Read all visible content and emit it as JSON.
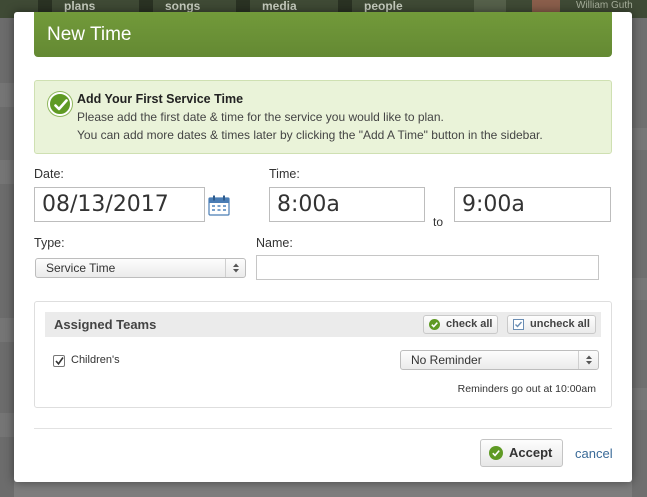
{
  "background": {
    "nav_items": [
      "plans",
      "songs",
      "media",
      "people"
    ],
    "user_name": "William Guth"
  },
  "modal": {
    "title": "New Time",
    "notice": {
      "title": "Add Your First Service Time",
      "line1": "Please add the first date & time for the service you would like to plan.",
      "line2": "You can add more dates & times later by clicking the \"Add A Time\" button in the sidebar."
    },
    "date": {
      "label": "Date:",
      "value": "08/13/2017"
    },
    "time": {
      "label": "Time:",
      "start": "8:00a",
      "separator": "to",
      "end": "9:00a"
    },
    "type": {
      "label": "Type:",
      "selected": "Service Time"
    },
    "name": {
      "label": "Name:",
      "value": ""
    },
    "teams": {
      "title": "Assigned Teams",
      "check_all_label": "check all",
      "uncheck_all_label": "uncheck all",
      "items": [
        {
          "name": "Children's",
          "checked": true,
          "reminder": "No Reminder"
        }
      ],
      "reminder_note": "Reminders go out at 10:00am"
    },
    "accept_label": "Accept",
    "cancel_label": "cancel"
  },
  "colors": {
    "header_green": "#6e9437",
    "notice_bg": "#eaf3d9",
    "check_green": "#5f9a24",
    "link_blue": "#3a6a98"
  }
}
